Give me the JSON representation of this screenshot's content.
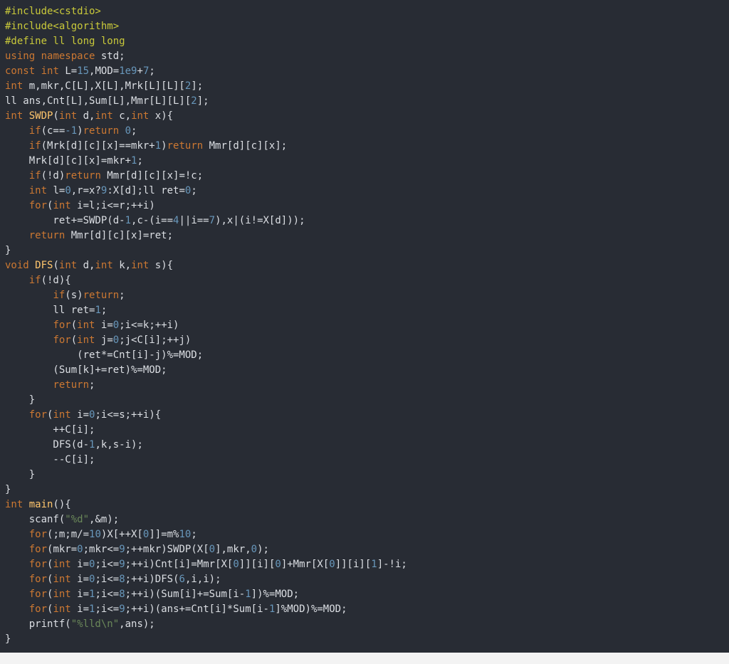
{
  "code_editor": {
    "colors": {
      "background": "#282c34",
      "text": "#dcdfe4",
      "preprocessor": "#c9c93a",
      "keyword": "#cc7832",
      "number": "#6897bb",
      "function": "#ffc66d",
      "string": "#6a8759"
    },
    "lines": [
      [
        [
          "pp",
          "#include<cstdio>"
        ]
      ],
      [
        [
          "pp",
          "#include<algorithm>"
        ]
      ],
      [
        [
          "pp",
          "#define ll long long"
        ]
      ],
      [
        [
          "kw",
          "using"
        ],
        [
          "plain",
          " "
        ],
        [
          "kw",
          "namespace"
        ],
        [
          "plain",
          " std;"
        ]
      ],
      [
        [
          "kw",
          "const"
        ],
        [
          "plain",
          " "
        ],
        [
          "kw",
          "int"
        ],
        [
          "plain",
          " L="
        ],
        [
          "num",
          "15"
        ],
        [
          "plain",
          ",MOD="
        ],
        [
          "num",
          "1e9"
        ],
        [
          "plain",
          "+"
        ],
        [
          "num",
          "7"
        ],
        [
          "plain",
          ";"
        ]
      ],
      [
        [
          "kw",
          "int"
        ],
        [
          "plain",
          " m,mkr,C[L],X[L],Mrk[L][L]["
        ],
        [
          "num",
          "2"
        ],
        [
          "plain",
          "];"
        ]
      ],
      [
        [
          "plain",
          "ll ans,Cnt[L],Sum[L],Mmr[L][L]["
        ],
        [
          "num",
          "2"
        ],
        [
          "plain",
          "];"
        ]
      ],
      [
        [
          "kw",
          "int"
        ],
        [
          "plain",
          " "
        ],
        [
          "fn",
          "SWDP"
        ],
        [
          "plain",
          "("
        ],
        [
          "kw",
          "int"
        ],
        [
          "plain",
          " d,"
        ],
        [
          "kw",
          "int"
        ],
        [
          "plain",
          " c,"
        ],
        [
          "kw",
          "int"
        ],
        [
          "plain",
          " x){"
        ]
      ],
      [
        [
          "plain",
          "    "
        ],
        [
          "kw",
          "if"
        ],
        [
          "plain",
          "(c=="
        ],
        [
          "num",
          "-1"
        ],
        [
          "plain",
          ")"
        ],
        [
          "kw",
          "return"
        ],
        [
          "plain",
          " "
        ],
        [
          "num",
          "0"
        ],
        [
          "plain",
          ";"
        ]
      ],
      [
        [
          "plain",
          "    "
        ],
        [
          "kw",
          "if"
        ],
        [
          "plain",
          "(Mrk[d][c][x]==mkr+"
        ],
        [
          "num",
          "1"
        ],
        [
          "plain",
          ")"
        ],
        [
          "kw",
          "return"
        ],
        [
          "plain",
          " Mmr[d][c][x];"
        ]
      ],
      [
        [
          "plain",
          "    Mrk[d][c][x]=mkr+"
        ],
        [
          "num",
          "1"
        ],
        [
          "plain",
          ";"
        ]
      ],
      [
        [
          "plain",
          "    "
        ],
        [
          "kw",
          "if"
        ],
        [
          "plain",
          "(!d)"
        ],
        [
          "kw",
          "return"
        ],
        [
          "plain",
          " Mmr[d][c][x]=!c;"
        ]
      ],
      [
        [
          "plain",
          "    "
        ],
        [
          "kw",
          "int"
        ],
        [
          "plain",
          " l="
        ],
        [
          "num",
          "0"
        ],
        [
          "plain",
          ",r=x?"
        ],
        [
          "num",
          "9"
        ],
        [
          "plain",
          ":X[d];ll ret="
        ],
        [
          "num",
          "0"
        ],
        [
          "plain",
          ";"
        ]
      ],
      [
        [
          "plain",
          "    "
        ],
        [
          "kw",
          "for"
        ],
        [
          "plain",
          "("
        ],
        [
          "kw",
          "int"
        ],
        [
          "plain",
          " i=l;i<=r;++i)"
        ]
      ],
      [
        [
          "plain",
          "        ret+=SWDP(d-"
        ],
        [
          "num",
          "1"
        ],
        [
          "plain",
          ",c-(i=="
        ],
        [
          "num",
          "4"
        ],
        [
          "plain",
          "||i=="
        ],
        [
          "num",
          "7"
        ],
        [
          "plain",
          "),x|(i!=X[d]));"
        ]
      ],
      [
        [
          "plain",
          "    "
        ],
        [
          "kw",
          "return"
        ],
        [
          "plain",
          " Mmr[d][c][x]=ret;"
        ]
      ],
      [
        [
          "plain",
          "}"
        ]
      ],
      [
        [
          "kw",
          "void"
        ],
        [
          "plain",
          " "
        ],
        [
          "fn",
          "DFS"
        ],
        [
          "plain",
          "("
        ],
        [
          "kw",
          "int"
        ],
        [
          "plain",
          " d,"
        ],
        [
          "kw",
          "int"
        ],
        [
          "plain",
          " k,"
        ],
        [
          "kw",
          "int"
        ],
        [
          "plain",
          " s){"
        ]
      ],
      [
        [
          "plain",
          "    "
        ],
        [
          "kw",
          "if"
        ],
        [
          "plain",
          "(!d){"
        ]
      ],
      [
        [
          "plain",
          "        "
        ],
        [
          "kw",
          "if"
        ],
        [
          "plain",
          "(s)"
        ],
        [
          "kw",
          "return"
        ],
        [
          "plain",
          ";"
        ]
      ],
      [
        [
          "plain",
          "        ll ret="
        ],
        [
          "num",
          "1"
        ],
        [
          "plain",
          ";"
        ]
      ],
      [
        [
          "plain",
          "        "
        ],
        [
          "kw",
          "for"
        ],
        [
          "plain",
          "("
        ],
        [
          "kw",
          "int"
        ],
        [
          "plain",
          " i="
        ],
        [
          "num",
          "0"
        ],
        [
          "plain",
          ";i<=k;++i)"
        ]
      ],
      [
        [
          "plain",
          "        "
        ],
        [
          "kw",
          "for"
        ],
        [
          "plain",
          "("
        ],
        [
          "kw",
          "int"
        ],
        [
          "plain",
          " j="
        ],
        [
          "num",
          "0"
        ],
        [
          "plain",
          ";j<C[i];++j)"
        ]
      ],
      [
        [
          "plain",
          "            (ret*=Cnt[i]-j)%=MOD;"
        ]
      ],
      [
        [
          "plain",
          "        (Sum[k]+=ret)%=MOD;"
        ]
      ],
      [
        [
          "plain",
          "        "
        ],
        [
          "kw",
          "return"
        ],
        [
          "plain",
          ";"
        ]
      ],
      [
        [
          "plain",
          "    }"
        ]
      ],
      [
        [
          "plain",
          "    "
        ],
        [
          "kw",
          "for"
        ],
        [
          "plain",
          "("
        ],
        [
          "kw",
          "int"
        ],
        [
          "plain",
          " i="
        ],
        [
          "num",
          "0"
        ],
        [
          "plain",
          ";i<=s;++i){"
        ]
      ],
      [
        [
          "plain",
          "        ++C[i];"
        ]
      ],
      [
        [
          "plain",
          "        DFS(d-"
        ],
        [
          "num",
          "1"
        ],
        [
          "plain",
          ",k,s-i);"
        ]
      ],
      [
        [
          "plain",
          "        --C[i];"
        ]
      ],
      [
        [
          "plain",
          "    }"
        ]
      ],
      [
        [
          "plain",
          "}"
        ]
      ],
      [
        [
          "kw",
          "int"
        ],
        [
          "plain",
          " "
        ],
        [
          "fn",
          "main"
        ],
        [
          "plain",
          "(){"
        ]
      ],
      [
        [
          "plain",
          "    scanf("
        ],
        [
          "str",
          "\"%d\""
        ],
        [
          "plain",
          ",&m);"
        ]
      ],
      [
        [
          "plain",
          "    "
        ],
        [
          "kw",
          "for"
        ],
        [
          "plain",
          "(;m;m/="
        ],
        [
          "num",
          "10"
        ],
        [
          "plain",
          ")X[++X["
        ],
        [
          "num",
          "0"
        ],
        [
          "plain",
          "]]=m%"
        ],
        [
          "num",
          "10"
        ],
        [
          "plain",
          ";"
        ]
      ],
      [
        [
          "plain",
          "    "
        ],
        [
          "kw",
          "for"
        ],
        [
          "plain",
          "(mkr="
        ],
        [
          "num",
          "0"
        ],
        [
          "plain",
          ";mkr<="
        ],
        [
          "num",
          "9"
        ],
        [
          "plain",
          ";++mkr)SWDP(X["
        ],
        [
          "num",
          "0"
        ],
        [
          "plain",
          "],mkr,"
        ],
        [
          "num",
          "0"
        ],
        [
          "plain",
          ");"
        ]
      ],
      [
        [
          "plain",
          "    "
        ],
        [
          "kw",
          "for"
        ],
        [
          "plain",
          "("
        ],
        [
          "kw",
          "int"
        ],
        [
          "plain",
          " i="
        ],
        [
          "num",
          "0"
        ],
        [
          "plain",
          ";i<="
        ],
        [
          "num",
          "9"
        ],
        [
          "plain",
          ";++i)Cnt[i]=Mmr[X["
        ],
        [
          "num",
          "0"
        ],
        [
          "plain",
          "]][i]["
        ],
        [
          "num",
          "0"
        ],
        [
          "plain",
          "]+Mmr[X["
        ],
        [
          "num",
          "0"
        ],
        [
          "plain",
          "]][i]["
        ],
        [
          "num",
          "1"
        ],
        [
          "plain",
          "]-!i;"
        ]
      ],
      [
        [
          "plain",
          "    "
        ],
        [
          "kw",
          "for"
        ],
        [
          "plain",
          "("
        ],
        [
          "kw",
          "int"
        ],
        [
          "plain",
          " i="
        ],
        [
          "num",
          "0"
        ],
        [
          "plain",
          ";i<="
        ],
        [
          "num",
          "8"
        ],
        [
          "plain",
          ";++i)DFS("
        ],
        [
          "num",
          "6"
        ],
        [
          "plain",
          ",i,i);"
        ]
      ],
      [
        [
          "plain",
          "    "
        ],
        [
          "kw",
          "for"
        ],
        [
          "plain",
          "("
        ],
        [
          "kw",
          "int"
        ],
        [
          "plain",
          " i="
        ],
        [
          "num",
          "1"
        ],
        [
          "plain",
          ";i<="
        ],
        [
          "num",
          "8"
        ],
        [
          "plain",
          ";++i)(Sum[i]+=Sum[i-"
        ],
        [
          "num",
          "1"
        ],
        [
          "plain",
          "])%=MOD;"
        ]
      ],
      [
        [
          "plain",
          "    "
        ],
        [
          "kw",
          "for"
        ],
        [
          "plain",
          "("
        ],
        [
          "kw",
          "int"
        ],
        [
          "plain",
          " i="
        ],
        [
          "num",
          "1"
        ],
        [
          "plain",
          ";i<="
        ],
        [
          "num",
          "9"
        ],
        [
          "plain",
          ";++i)(ans+=Cnt[i]*Sum[i-"
        ],
        [
          "num",
          "1"
        ],
        [
          "plain",
          "]%MOD)%=MOD;"
        ]
      ],
      [
        [
          "plain",
          "    printf("
        ],
        [
          "str",
          "\"%lld\\n\""
        ],
        [
          "plain",
          ",ans);"
        ]
      ],
      [
        [
          "plain",
          "}"
        ]
      ]
    ]
  }
}
